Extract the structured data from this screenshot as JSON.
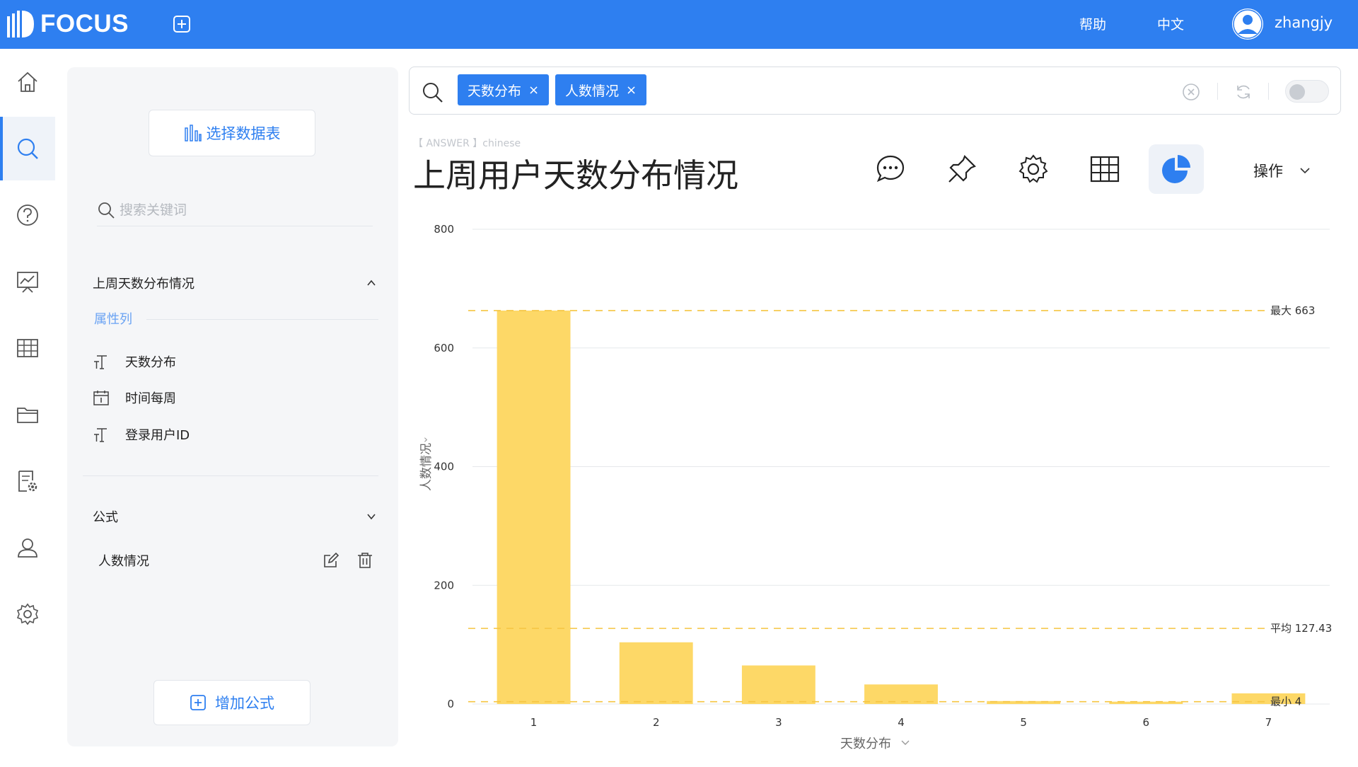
{
  "header": {
    "logo_text": "FOCUS",
    "help": "帮助",
    "lang": "中文",
    "username": "zhangjy",
    "color": "#2e7ff0"
  },
  "nav": {
    "items": [
      "home-icon",
      "search-icon",
      "help-icon",
      "dashboard-icon",
      "table-icon",
      "folder-icon",
      "report-settings-icon",
      "user-icon",
      "settings-icon"
    ],
    "active": "search-icon"
  },
  "panel": {
    "select_table": "选择数据表",
    "search_placeholder": "搜索关键词",
    "table_name": "上周天数分布情况",
    "attr_label": "属性列",
    "fields": [
      {
        "name": "天数分布",
        "icon": "text-type-icon"
      },
      {
        "name": "时间每周",
        "icon": "calendar-icon"
      },
      {
        "name": "登录用户ID",
        "icon": "text-type-icon"
      }
    ],
    "formula_section": "公式",
    "formula_item": "人数情况",
    "add_formula": "增加公式"
  },
  "searchbar": {
    "chips": [
      "天数分布",
      "人数情况"
    ],
    "close_glyph": "×"
  },
  "answer": {
    "tag": "【 ANSWER 】chinese",
    "title": "上周用户天数分布情况",
    "ops": "操作",
    "toolbar": [
      "comment-icon",
      "pin-icon",
      "gear-icon",
      "table-icon",
      "pie-chart-icon"
    ],
    "active_tool": "pie-chart-icon"
  },
  "chart_data": {
    "type": "bar",
    "categories": [
      "1",
      "2",
      "3",
      "4",
      "5",
      "6",
      "7"
    ],
    "values": [
      663,
      104,
      65,
      33,
      5,
      4,
      18
    ],
    "ylabel": "人数情况",
    "xlabel": "天数分布",
    "ylim": [
      0,
      800
    ],
    "yticks": [
      0,
      200,
      400,
      600,
      800
    ],
    "bar_color": "#fdd867",
    "ref_lines": [
      {
        "label": "最大 663",
        "value": 663
      },
      {
        "label": "平均 127.43",
        "value": 127.43
      },
      {
        "label": "最小 4",
        "value": 4
      }
    ],
    "ref_color": "#f5c542",
    "grid": true
  }
}
